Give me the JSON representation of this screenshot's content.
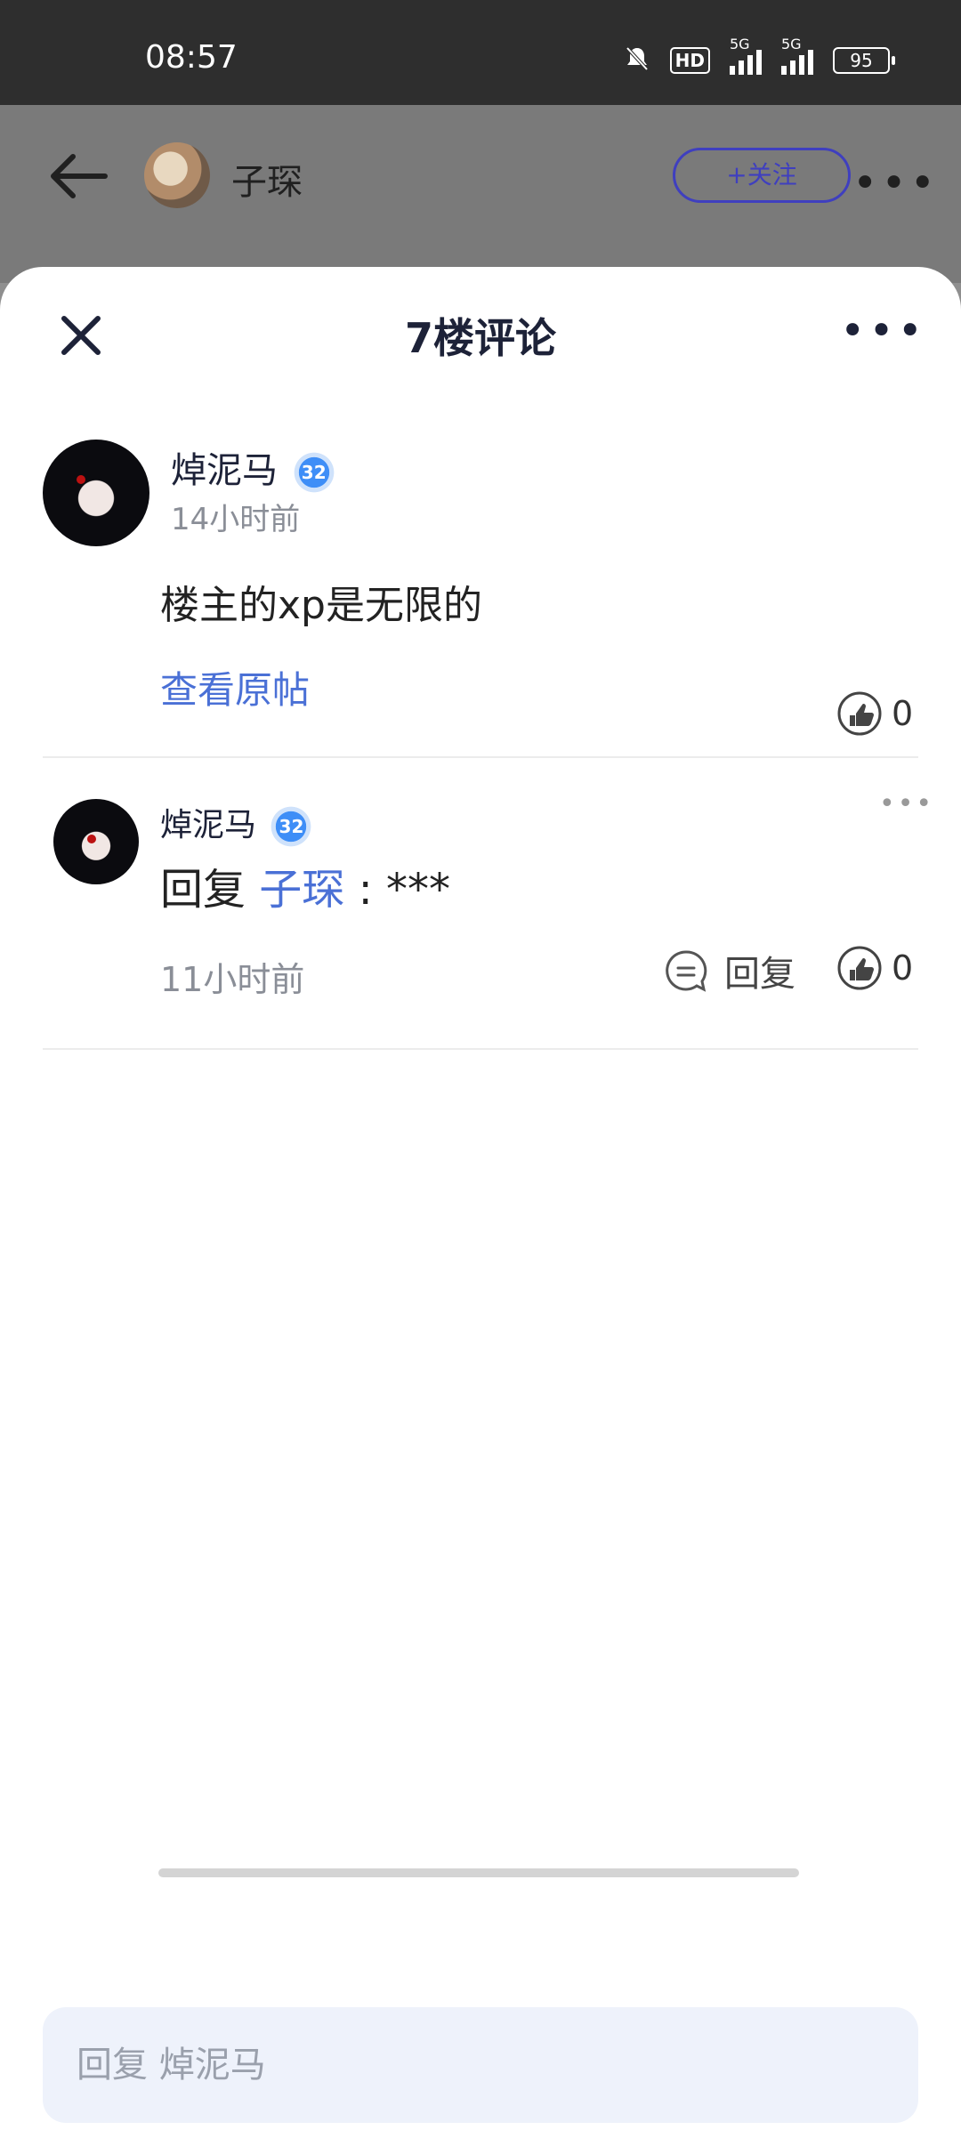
{
  "status_bar": {
    "time": "08:57",
    "hd_label": "HD",
    "signal_label_1": "5G",
    "signal_label_2": "5G",
    "battery": "95",
    "icons": [
      "mute-bell-icon",
      "hd-icon",
      "signal-icon",
      "signal-icon",
      "battery-icon"
    ]
  },
  "nav": {
    "back_icon": "arrow-left-icon",
    "user_name": "子琛",
    "follow_label": "+关注",
    "more_label": "•••"
  },
  "sheet": {
    "title": "7楼评论",
    "close_icon": "close-icon",
    "more_label": "•••"
  },
  "main_comment": {
    "user_name": "焯泥马",
    "level": "32",
    "time": "14小时前",
    "text": "楼主的xp是无限的",
    "view_original": "查看原帖",
    "likes": "0"
  },
  "reply": {
    "user_name": "焯泥马",
    "level": "32",
    "prefix": "回复",
    "target": "子琛",
    "text": ": ***",
    "time": "11小时前",
    "reply_label": "回复",
    "likes": "0",
    "more_label": "•••"
  },
  "input": {
    "placeholder": "回复 焯泥马"
  },
  "colors": {
    "accent_blue": "#4a70d6",
    "follow_purple": "#3f3fbf",
    "input_bg": "#eef2fb"
  }
}
